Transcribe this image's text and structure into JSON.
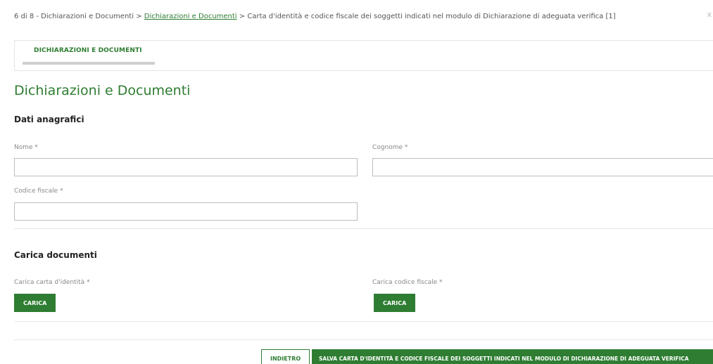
{
  "breadcrumb": {
    "step": "6 di 8 - Dichiarazioni e Documenti",
    "sep1": ">",
    "link": "Dichiarazioni e Documenti",
    "sep2": ">",
    "current": "Carta d'identità e codice fiscale dei soggetti indicati nel modulo di Dichiarazione di adeguata verifica [1]"
  },
  "close_symbol": "x",
  "tabs": [
    {
      "label": "DICHIARAZIONI E DOCUMENTI",
      "active": true
    }
  ],
  "section_title": "Dichiarazioni e Documenti",
  "anagrafici": {
    "title": "Dati anagrafici",
    "nome_label": "Nome *",
    "nome_value": "",
    "cognome_label": "Cognome *",
    "cognome_value": "",
    "codice_fiscale_label": "Codice fiscale *",
    "codice_fiscale_value": ""
  },
  "documenti": {
    "title": "Carica documenti",
    "carta_label": "Carica carta d'identità *",
    "carta_button": "CARICA",
    "cf_label": "Carica codice fiscale *",
    "cf_button": "CARICA"
  },
  "footer": {
    "back_button": "INDIETRO",
    "save_button": "SALVA CARTA D'IDENTITÀ E CODICE FISCALE DEI SOGGETTI INDICATI NEL MODULO DI DICHIARAZIONE DI ADEGUATA VERIFICA"
  },
  "colors": {
    "accent": "#2e7d32",
    "border": "#bdbdbd",
    "divider": "#e6e6e6"
  }
}
